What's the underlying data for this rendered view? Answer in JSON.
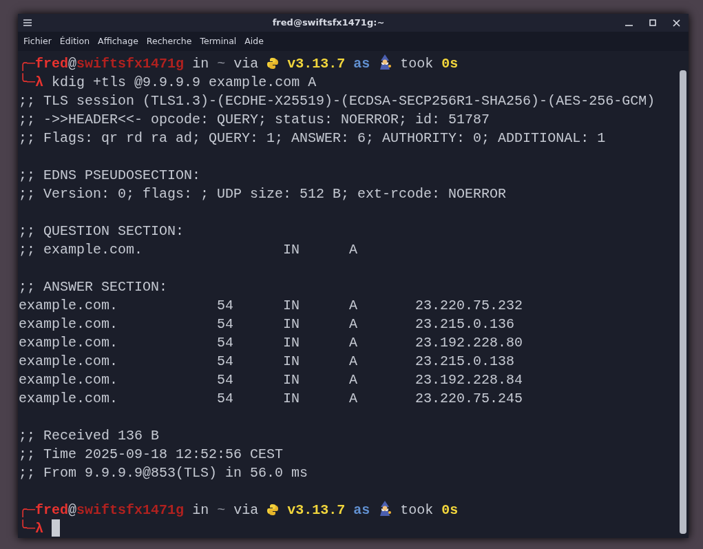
{
  "window": {
    "title": "fred@swiftsfx1471g:~"
  },
  "menu": [
    "Fichier",
    "Édition",
    "Affichage",
    "Recherche",
    "Terminal",
    "Aide"
  ],
  "terminal": {
    "lines": [
      {
        "kind": "prompt",
        "corner": "╭─",
        "user": "fred",
        "at": "@",
        "host": "swiftsfx1471g",
        "in": "in",
        "dir": "~",
        "via": "via",
        "python_version": "v3.13.7",
        "as": "as",
        "took": "took",
        "duration": "0s"
      },
      {
        "kind": "command",
        "corner": "╰─",
        "symbol": "λ",
        "command": "kdig +tls @9.9.9.9 example.com A",
        "cursor": false
      },
      {
        "kind": "text",
        "text": ";; TLS session (TLS1.3)-(ECDHE-X25519)-(ECDSA-SECP256R1-SHA256)-(AES-256-GCM)"
      },
      {
        "kind": "text",
        "text": ";; ->>HEADER<<- opcode: QUERY; status: NOERROR; id: 51787"
      },
      {
        "kind": "text",
        "text": ";; Flags: qr rd ra ad; QUERY: 1; ANSWER: 6; AUTHORITY: 0; ADDITIONAL: 1"
      },
      {
        "kind": "blank"
      },
      {
        "kind": "text",
        "text": ";; EDNS PSEUDOSECTION:"
      },
      {
        "kind": "text",
        "text": ";; Version: 0; flags: ; UDP size: 512 B; ext-rcode: NOERROR"
      },
      {
        "kind": "blank"
      },
      {
        "kind": "text",
        "text": ";; QUESTION SECTION:"
      },
      {
        "kind": "text",
        "text": ";; example.com.                 IN      A"
      },
      {
        "kind": "blank"
      },
      {
        "kind": "text",
        "text": ";; ANSWER SECTION:"
      },
      {
        "kind": "text",
        "text": "example.com.            54      IN      A       23.220.75.232"
      },
      {
        "kind": "text",
        "text": "example.com.            54      IN      A       23.215.0.136"
      },
      {
        "kind": "text",
        "text": "example.com.            54      IN      A       23.192.228.80"
      },
      {
        "kind": "text",
        "text": "example.com.            54      IN      A       23.215.0.138"
      },
      {
        "kind": "text",
        "text": "example.com.            54      IN      A       23.192.228.84"
      },
      {
        "kind": "text",
        "text": "example.com.            54      IN      A       23.220.75.245"
      },
      {
        "kind": "blank"
      },
      {
        "kind": "text",
        "text": ";; Received 136 B"
      },
      {
        "kind": "text",
        "text": ";; Time 2025-09-18 12:52:56 CEST"
      },
      {
        "kind": "text",
        "text": ";; From 9.9.9.9@853(TLS) in 56.0 ms"
      },
      {
        "kind": "blank"
      },
      {
        "kind": "prompt",
        "corner": "╭─",
        "user": "fred",
        "at": "@",
        "host": "swiftsfx1471g",
        "in": "in",
        "dir": "~",
        "via": "via",
        "python_version": "v3.13.7",
        "as": "as",
        "took": "took",
        "duration": "0s"
      },
      {
        "kind": "command",
        "corner": "╰─",
        "symbol": "λ",
        "cursor": true
      }
    ]
  }
}
